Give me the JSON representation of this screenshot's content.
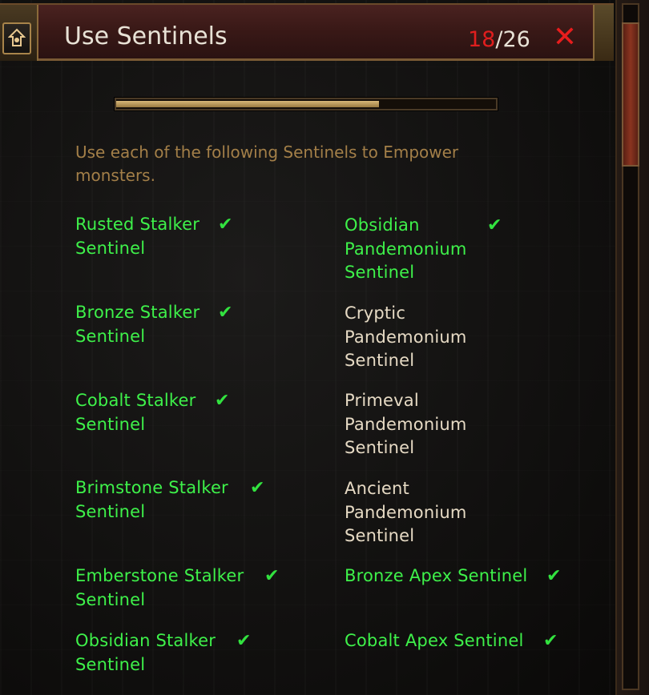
{
  "window": {
    "title": "Use Sentinels",
    "progress": {
      "completed": "18",
      "separator": "/",
      "total": "26",
      "fraction": 0.692
    },
    "close_symbol": "✕",
    "home_icon": "home-icon"
  },
  "description": "Use each of the following Sentinels to Empower monsters.",
  "colors": {
    "complete": "#3ef14a",
    "incomplete": "#e6dac4",
    "description": "#a37f48",
    "counter_done": "#e01e1e",
    "close": "#e81d1d"
  },
  "left_column": [
    {
      "label": "Rusted Stalker Sentinel",
      "lines": [
        "Rusted Stalker",
        "Sentinel"
      ],
      "complete": true
    },
    {
      "label": "Bronze Stalker Sentinel",
      "lines": [
        "Bronze Stalker",
        "Sentinel"
      ],
      "complete": true
    },
    {
      "label": "Cobalt Stalker Sentinel",
      "lines": [
        "Cobalt Stalker",
        "Sentinel"
      ],
      "complete": true
    },
    {
      "label": "Brimstone Stalker Sentinel",
      "lines": [
        "Brimstone Stalker",
        "Sentinel"
      ],
      "complete": true
    },
    {
      "label": "Emberstone Stalker Sentinel",
      "lines": [
        "Emberstone Stalker",
        "Sentinel"
      ],
      "complete": true
    },
    {
      "label": "Obsidian Stalker Sentinel",
      "lines": [
        "Obsidian Stalker",
        "Sentinel"
      ],
      "complete": true
    }
  ],
  "right_column": [
    {
      "label": "Obsidian Pandemonium Sentinel",
      "lines": [
        "Obsidian",
        "Pandemonium",
        "Sentinel"
      ],
      "complete": true
    },
    {
      "label": "Cryptic Pandemonium Sentinel",
      "lines": [
        "Cryptic",
        "Pandemonium",
        "Sentinel"
      ],
      "complete": false
    },
    {
      "label": "Primeval Pandemonium Sentinel",
      "lines": [
        "Primeval",
        "Pandemonium",
        "Sentinel"
      ],
      "complete": false
    },
    {
      "label": "Ancient Pandemonium Sentinel",
      "lines": [
        "Ancient",
        "Pandemonium",
        "Sentinel"
      ],
      "complete": false
    },
    {
      "label": "Bronze Apex Sentinel",
      "lines": [
        "Bronze Apex Sentinel"
      ],
      "complete": true
    },
    {
      "label": "Cobalt Apex Sentinel",
      "lines": [
        "Cobalt Apex Sentinel"
      ],
      "complete": true
    }
  ],
  "check_symbol": "✔"
}
